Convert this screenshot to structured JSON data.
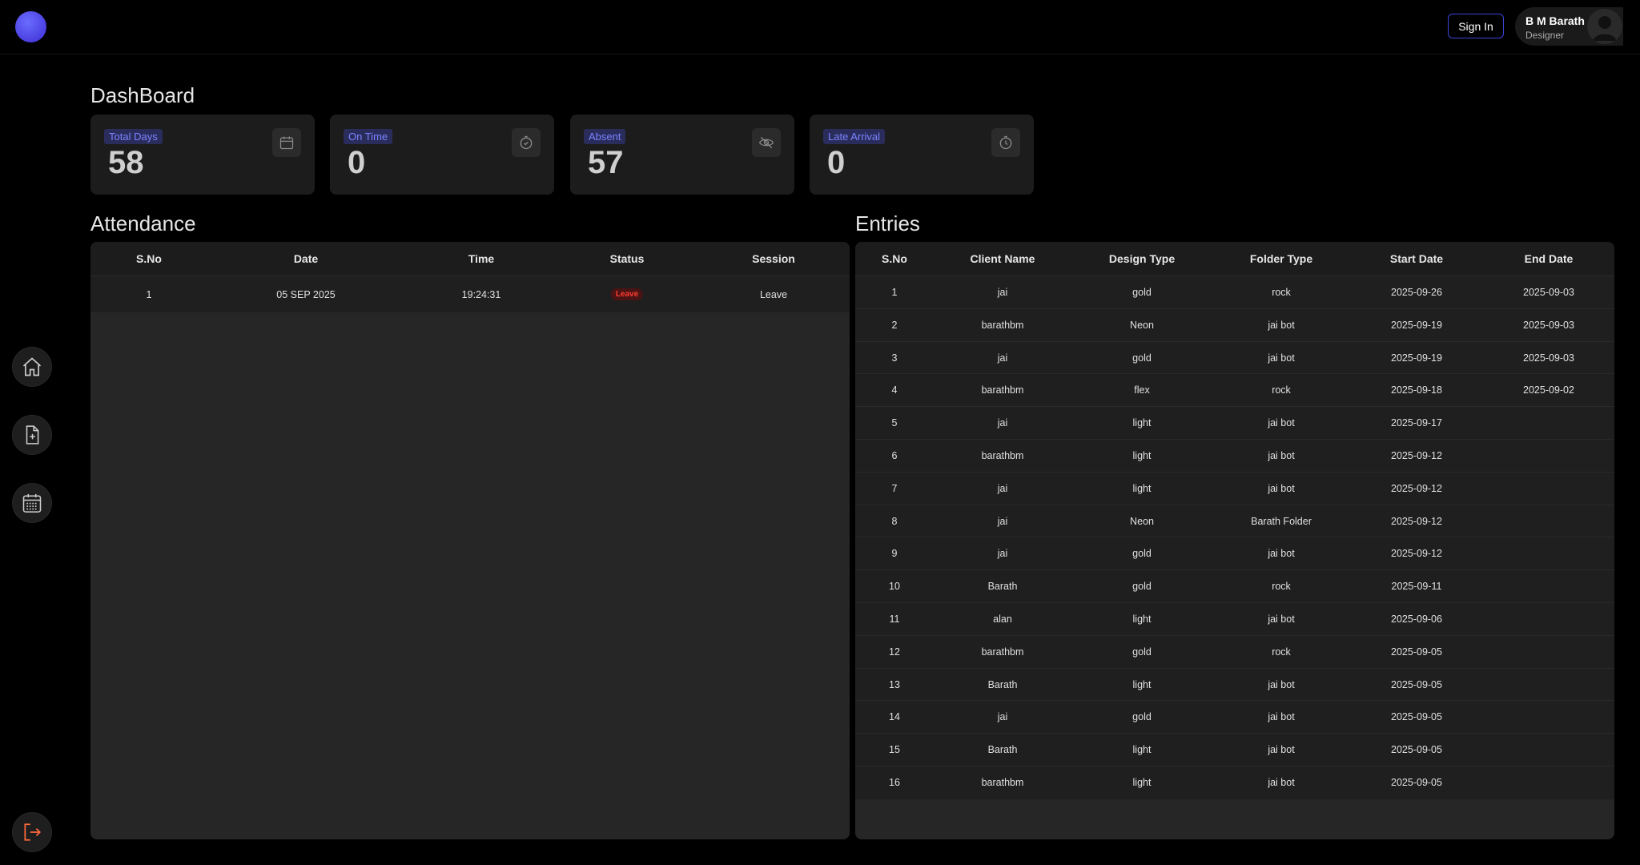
{
  "header": {
    "sign_in_label": "Sign In",
    "user_name": "B M Barath",
    "user_role": "Designer"
  },
  "sidebar": {
    "items": [
      {
        "icon": "home-icon"
      },
      {
        "icon": "add-file-icon"
      },
      {
        "icon": "calendar-icon"
      },
      {
        "icon": "logout-icon"
      }
    ]
  },
  "dashboard": {
    "title": "DashBoard",
    "cards": [
      {
        "label": "Total Days",
        "value": "58",
        "icon": "calendar-icon"
      },
      {
        "label": "On Time",
        "value": "0",
        "icon": "clock-check-icon"
      },
      {
        "label": "Absent",
        "value": "57",
        "icon": "eye-off-icon"
      },
      {
        "label": "Late Arrival",
        "value": "0",
        "icon": "clock-alert-icon"
      }
    ]
  },
  "attendance": {
    "title": "Attendance",
    "columns": [
      "S.No",
      "Date",
      "Time",
      "Status",
      "Session"
    ],
    "rows": [
      {
        "sno": "1",
        "date": "05 SEP 2025",
        "time": "19:24:31",
        "status": "Leave",
        "session": "Leave"
      }
    ]
  },
  "entries": {
    "title": "Entries",
    "columns": [
      "S.No",
      "Client Name",
      "Design Type",
      "Folder Type",
      "Start Date",
      "End Date"
    ],
    "rows": [
      {
        "sno": "1",
        "client": "jai",
        "design": "gold",
        "folder": "rock",
        "start": "2025-09-26",
        "end": "2025-09-03"
      },
      {
        "sno": "2",
        "client": "barathbm",
        "design": "Neon",
        "folder": "jai bot",
        "start": "2025-09-19",
        "end": "2025-09-03"
      },
      {
        "sno": "3",
        "client": "jai",
        "design": "gold",
        "folder": "jai bot",
        "start": "2025-09-19",
        "end": "2025-09-03"
      },
      {
        "sno": "4",
        "client": "barathbm",
        "design": "flex",
        "folder": "rock",
        "start": "2025-09-18",
        "end": "2025-09-02"
      },
      {
        "sno": "5",
        "client": "jai",
        "design": "light",
        "folder": "jai bot",
        "start": "2025-09-17",
        "end": ""
      },
      {
        "sno": "6",
        "client": "barathbm",
        "design": "light",
        "folder": "jai bot",
        "start": "2025-09-12",
        "end": ""
      },
      {
        "sno": "7",
        "client": "jai",
        "design": "light",
        "folder": "jai bot",
        "start": "2025-09-12",
        "end": ""
      },
      {
        "sno": "8",
        "client": "jai",
        "design": "Neon",
        "folder": "Barath Folder",
        "start": "2025-09-12",
        "end": ""
      },
      {
        "sno": "9",
        "client": "jai",
        "design": "gold",
        "folder": "jai bot",
        "start": "2025-09-12",
        "end": ""
      },
      {
        "sno": "10",
        "client": "Barath",
        "design": "gold",
        "folder": "rock",
        "start": "2025-09-11",
        "end": ""
      },
      {
        "sno": "11",
        "client": "alan",
        "design": "light",
        "folder": "jai bot",
        "start": "2025-09-06",
        "end": ""
      },
      {
        "sno": "12",
        "client": "barathbm",
        "design": "gold",
        "folder": "rock",
        "start": "2025-09-05",
        "end": ""
      },
      {
        "sno": "13",
        "client": "Barath",
        "design": "light",
        "folder": "jai bot",
        "start": "2025-09-05",
        "end": ""
      },
      {
        "sno": "14",
        "client": "jai",
        "design": "gold",
        "folder": "jai bot",
        "start": "2025-09-05",
        "end": ""
      },
      {
        "sno": "15",
        "client": "Barath",
        "design": "light",
        "folder": "jai bot",
        "start": "2025-09-05",
        "end": ""
      },
      {
        "sno": "16",
        "client": "barathbm",
        "design": "light",
        "folder": "jai bot",
        "start": "2025-09-05",
        "end": ""
      }
    ]
  },
  "colors": {
    "accent": "#4a3fe0",
    "tag_text": "#7c83ff",
    "leave_red": "#ff3b30",
    "logout_orange": "#ff6a3d"
  }
}
